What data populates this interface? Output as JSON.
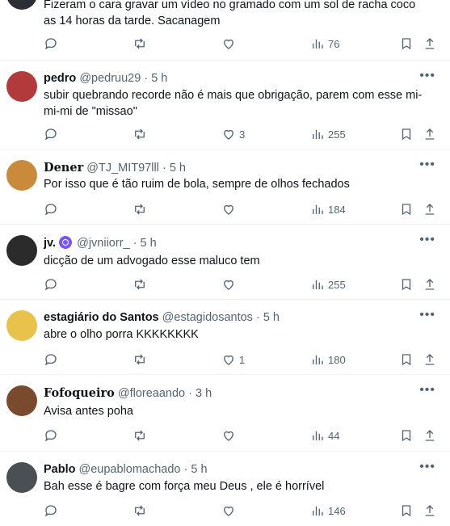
{
  "posts": [
    {
      "text": "Fizeram o cara gravar um vídeo no gramado com um sol de racha coco as 14 horas da tarde. Sacanagem",
      "views": "76"
    },
    {
      "name": "pedro",
      "handle": "@pedruu29",
      "sep": "·",
      "time": "5 h",
      "text": "subir quebrando recorde não é mais que obrigação, parem com esse mi-mi-mi de \"missao\"",
      "likes": "3",
      "views": "255",
      "avatar_color": "#b23a3a"
    },
    {
      "name": "Dener",
      "handle": "@TJ_MIT97lll",
      "sep": "·",
      "time": "5 h",
      "text": "Por isso que é tão ruim de bola, sempre de olhos fechados",
      "views": "184",
      "avatar_color": "#c98a3c"
    },
    {
      "name": "jv.",
      "handle": "@jvniiorr_",
      "sep": "·",
      "time": "5 h",
      "text": "dicção de um advogado esse maluco tem",
      "views": "255",
      "avatar_color": "#2b2b2b",
      "badge_color": "#7856ff"
    },
    {
      "name": "estagiário do Santos",
      "handle": "@estagidosantos",
      "sep": "·",
      "time": "5 h",
      "text": "abre o olho porra KKKKKKKK",
      "likes": "1",
      "views": "180",
      "avatar_color": "#e8c24a"
    },
    {
      "name": "Fofoqueiro",
      "handle": "@floreaando",
      "sep": "·",
      "time": "3 h",
      "text": "Avisa antes poha",
      "views": "44",
      "avatar_color": "#7a4a2e"
    },
    {
      "name": "Pablo",
      "handle": "@eupablomachado",
      "sep": "·",
      "time": "5 h",
      "text": "Bah esse é bagre com força meu Deus , ele é horrível",
      "views": "146",
      "avatar_color": "#4a4f55"
    }
  ],
  "icons": {
    "reply": "reply-icon",
    "retweet": "retweet-icon",
    "like": "like-icon",
    "views": "views-icon",
    "bookmark": "bookmark-icon",
    "share": "share-icon",
    "more": "more-icon"
  }
}
